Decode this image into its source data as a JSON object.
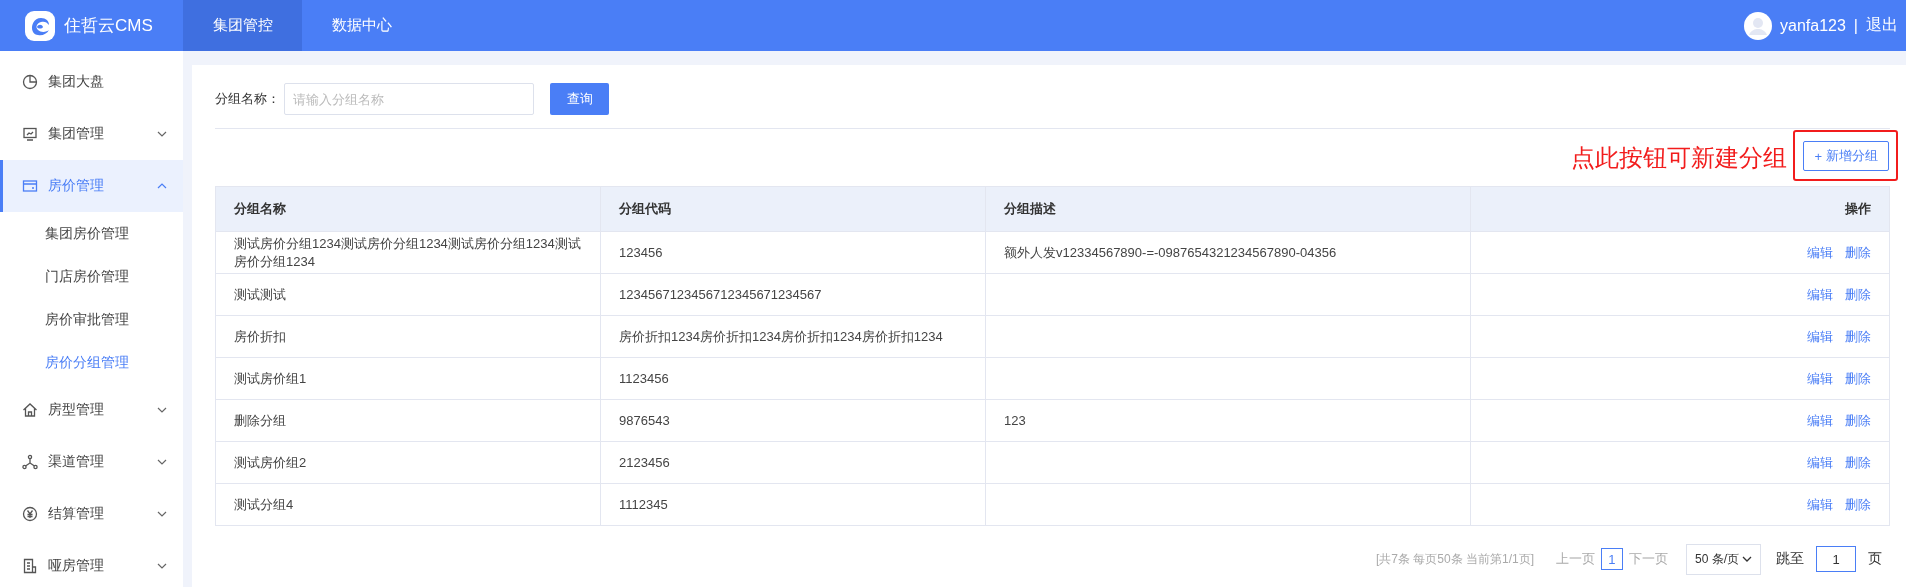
{
  "header": {
    "logo_text": "住哲云CMS",
    "nav": [
      {
        "label": "集团管控",
        "selected": true
      },
      {
        "label": "数据中心",
        "selected": false
      }
    ],
    "user": "yanfa123",
    "separator": "|",
    "logout": "退出"
  },
  "sidebar": {
    "items": [
      {
        "label": "集团大盘",
        "kind": "link",
        "selected": false
      },
      {
        "label": "集团管理",
        "kind": "group",
        "expanded": false,
        "selected": false
      },
      {
        "label": "房价管理",
        "kind": "group",
        "expanded": true,
        "selected": true,
        "children": [
          {
            "label": "集团房价管理",
            "selected": false
          },
          {
            "label": "门店房价管理",
            "selected": false
          },
          {
            "label": "房价审批管理",
            "selected": false
          },
          {
            "label": "房价分组管理",
            "selected": true
          }
        ]
      },
      {
        "label": "房型管理",
        "kind": "group",
        "expanded": false,
        "selected": false
      },
      {
        "label": "渠道管理",
        "kind": "group",
        "expanded": false,
        "selected": false
      },
      {
        "label": "结算管理",
        "kind": "group",
        "expanded": false,
        "selected": false
      },
      {
        "label": "哑房管理",
        "kind": "group",
        "expanded": false,
        "selected": false
      }
    ]
  },
  "filter": {
    "label": "分组名称：",
    "placeholder": "请输入分组名称",
    "button": "查询"
  },
  "toolbar": {
    "annotation": "点此按钮可新建分组",
    "add_icon": "+",
    "add_button": "新增分组"
  },
  "table": {
    "columns": [
      "分组名称",
      "分组代码",
      "分组描述",
      "操作"
    ],
    "rows": [
      {
        "name": "测试房价分组1234测试房价分组1234测试房价分组1234测试房价分组1234",
        "code": "123456",
        "description": "额外人发v12334567890-=-0987654321234567890-04356",
        "actions": [
          "编辑",
          "删除"
        ]
      },
      {
        "name": "测试测试",
        "code": "1234567123456712345671234567",
        "actions": [
          "编辑",
          "删除"
        ]
      },
      {
        "name": "房价折扣",
        "code": "房价折扣1234房价折扣1234房价折扣1234房价折扣1234",
        "actions": [
          "编辑",
          "删除"
        ]
      },
      {
        "name": "测试房价组1",
        "code": "1123456",
        "actions": [
          "编辑",
          "删除"
        ]
      },
      {
        "name": "删除分组",
        "code": "9876543",
        "description": "123",
        "actions": [
          "编辑",
          "删除"
        ]
      },
      {
        "name": "测试房价组2",
        "code": "2123456",
        "actions": [
          "编辑",
          "删除"
        ]
      },
      {
        "name": "测试分组4",
        "code": "1112345",
        "actions": [
          "编辑",
          "删除"
        ]
      }
    ]
  },
  "pagination": {
    "summary": "[共7条 每页50条 当前第1/1页]",
    "prev": "上一页",
    "pages": [
      {
        "label": "1",
        "selected": true
      }
    ],
    "next": "下一页",
    "page_size": "50 条/页",
    "jump_label": "跳至",
    "jump_value": "1",
    "page_unit": "页"
  }
}
